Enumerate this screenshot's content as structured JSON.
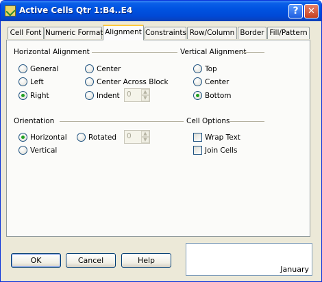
{
  "window": {
    "title": "Active Cells  Qtr 1:B4..E4",
    "help_button": "?",
    "close_button": "✕"
  },
  "tabs": [
    {
      "label": "Cell Font"
    },
    {
      "label": "Numeric Format"
    },
    {
      "label": "Alignment",
      "active": true
    },
    {
      "label": "Constraints"
    },
    {
      "label": "Row/Column"
    },
    {
      "label": "Border"
    },
    {
      "label": "Fill/Pattern"
    }
  ],
  "horizontal_alignment": {
    "label": "Horizontal Alignment",
    "options": {
      "general": "General",
      "left": "Left",
      "right": "Right",
      "center": "Center",
      "center_across_block": "Center Across Block",
      "indent": "Indent"
    },
    "selected": "Right",
    "indent_value": "0"
  },
  "vertical_alignment": {
    "label": "Vertical Alignment",
    "options": {
      "top": "Top",
      "center": "Center",
      "bottom": "Bottom"
    },
    "selected": "Bottom"
  },
  "orientation": {
    "label": "Orientation",
    "options": {
      "horizontal": "Horizontal",
      "vertical": "Vertical",
      "rotated": "Rotated"
    },
    "selected": "Horizontal",
    "rotated_value": "0"
  },
  "cell_options": {
    "label": "Cell Options",
    "wrap_text": {
      "label": "Wrap Text",
      "checked": false
    },
    "join_cells": {
      "label": "Join Cells",
      "checked": false
    }
  },
  "buttons": {
    "ok": "OK",
    "cancel": "Cancel",
    "help": "Help"
  },
  "preview": {
    "text": "January"
  },
  "colors": {
    "title_bar": "#0053e1",
    "active_tab_accent": "#ffc83c",
    "radio_dot": "#21a121"
  }
}
